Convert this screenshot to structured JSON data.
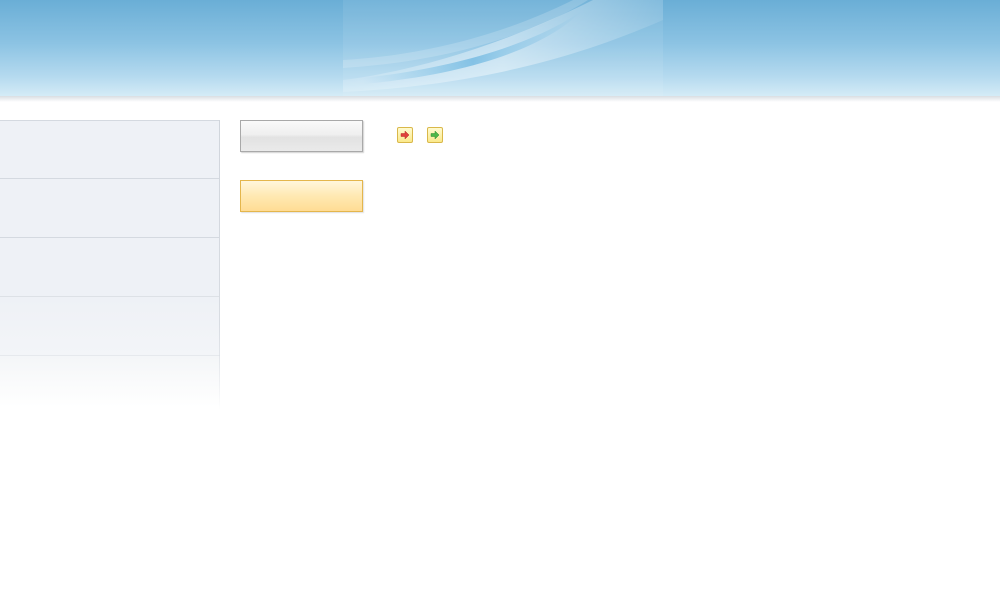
{
  "header": {
    "banner_icon": "sky-banner"
  },
  "sidebar": {
    "items": [
      {
        "label": ""
      },
      {
        "label": ""
      },
      {
        "label": ""
      },
      {
        "label": ""
      },
      {
        "label": ""
      }
    ]
  },
  "toolbar": {
    "gray_button_label": "",
    "yellow_button_label": "",
    "red_arrow_icon": "arrow-right-red-icon",
    "green_arrow_icon": "arrow-right-green-icon"
  },
  "colors": {
    "header_blue": "#6aaed6",
    "sidebar_bg": "#eef1f6",
    "yellow_button": "#ffe9b2",
    "red_arrow": "#e0403a",
    "green_arrow": "#4cb848"
  }
}
